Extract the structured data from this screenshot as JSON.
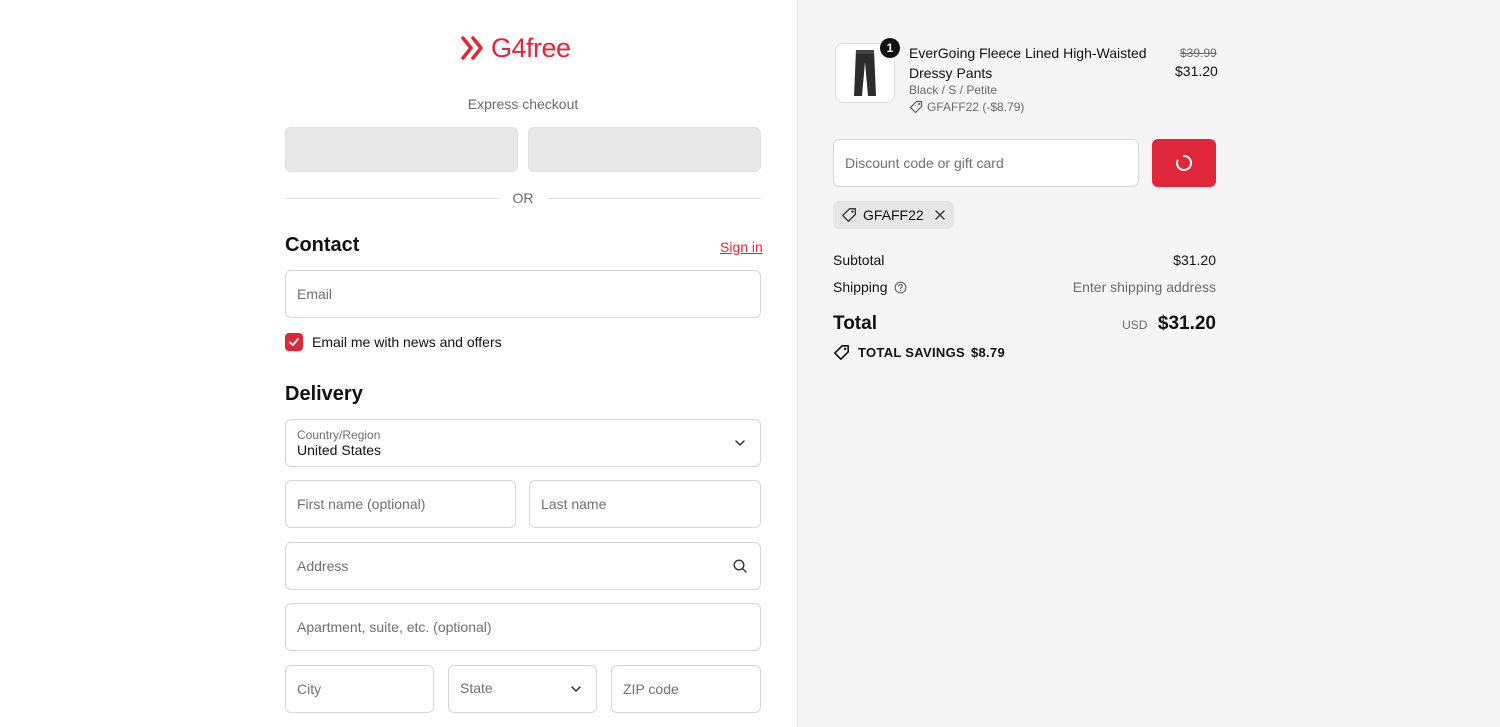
{
  "brand": {
    "name": "G4free",
    "accent": "#e0263b"
  },
  "express": {
    "label": "Express checkout",
    "divider": "OR"
  },
  "contact": {
    "heading": "Contact",
    "signin": "Sign in",
    "email_placeholder": "Email",
    "newsletter_label": "Email me with news and offers",
    "newsletter_checked": true
  },
  "delivery": {
    "heading": "Delivery",
    "country_label": "Country/Region",
    "country_value": "United States",
    "first_name_placeholder": "First name (optional)",
    "last_name_placeholder": "Last name",
    "address_placeholder": "Address",
    "apartment_placeholder": "Apartment, suite, etc. (optional)",
    "city_placeholder": "City",
    "state_placeholder": "State",
    "zip_placeholder": "ZIP code"
  },
  "cart": {
    "item": {
      "quantity": "1",
      "name": "EverGoing Fleece Lined High-Waisted Dressy Pants",
      "variant": "Black / S / Petite",
      "discount": "GFAFF22 (-$8.79)",
      "original_price": "$39.99",
      "price": "$31.20"
    },
    "discount_placeholder": "Discount code or gift card",
    "applied_code": "GFAFF22",
    "subtotal_label": "Subtotal",
    "subtotal_value": "$31.20",
    "shipping_label": "Shipping",
    "shipping_value": "Enter shipping address",
    "total_label": "Total",
    "currency": "USD",
    "total_value": "$31.20",
    "savings_label": "TOTAL SAVINGS",
    "savings_value": "$8.79"
  }
}
